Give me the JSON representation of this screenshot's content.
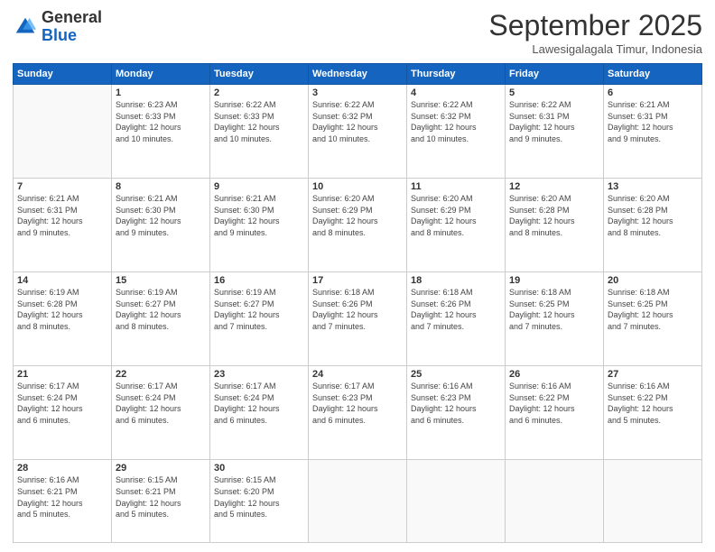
{
  "logo": {
    "line1": "General",
    "line2": "Blue"
  },
  "title": "September 2025",
  "subtitle": "Lawesigalagala Timur, Indonesia",
  "days_header": [
    "Sunday",
    "Monday",
    "Tuesday",
    "Wednesday",
    "Thursday",
    "Friday",
    "Saturday"
  ],
  "weeks": [
    [
      {
        "day": "",
        "info": ""
      },
      {
        "day": "1",
        "info": "Sunrise: 6:23 AM\nSunset: 6:33 PM\nDaylight: 12 hours\nand 10 minutes."
      },
      {
        "day": "2",
        "info": "Sunrise: 6:22 AM\nSunset: 6:33 PM\nDaylight: 12 hours\nand 10 minutes."
      },
      {
        "day": "3",
        "info": "Sunrise: 6:22 AM\nSunset: 6:32 PM\nDaylight: 12 hours\nand 10 minutes."
      },
      {
        "day": "4",
        "info": "Sunrise: 6:22 AM\nSunset: 6:32 PM\nDaylight: 12 hours\nand 10 minutes."
      },
      {
        "day": "5",
        "info": "Sunrise: 6:22 AM\nSunset: 6:31 PM\nDaylight: 12 hours\nand 9 minutes."
      },
      {
        "day": "6",
        "info": "Sunrise: 6:21 AM\nSunset: 6:31 PM\nDaylight: 12 hours\nand 9 minutes."
      }
    ],
    [
      {
        "day": "7",
        "info": "Sunrise: 6:21 AM\nSunset: 6:31 PM\nDaylight: 12 hours\nand 9 minutes."
      },
      {
        "day": "8",
        "info": "Sunrise: 6:21 AM\nSunset: 6:30 PM\nDaylight: 12 hours\nand 9 minutes."
      },
      {
        "day": "9",
        "info": "Sunrise: 6:21 AM\nSunset: 6:30 PM\nDaylight: 12 hours\nand 9 minutes."
      },
      {
        "day": "10",
        "info": "Sunrise: 6:20 AM\nSunset: 6:29 PM\nDaylight: 12 hours\nand 8 minutes."
      },
      {
        "day": "11",
        "info": "Sunrise: 6:20 AM\nSunset: 6:29 PM\nDaylight: 12 hours\nand 8 minutes."
      },
      {
        "day": "12",
        "info": "Sunrise: 6:20 AM\nSunset: 6:28 PM\nDaylight: 12 hours\nand 8 minutes."
      },
      {
        "day": "13",
        "info": "Sunrise: 6:20 AM\nSunset: 6:28 PM\nDaylight: 12 hours\nand 8 minutes."
      }
    ],
    [
      {
        "day": "14",
        "info": "Sunrise: 6:19 AM\nSunset: 6:28 PM\nDaylight: 12 hours\nand 8 minutes."
      },
      {
        "day": "15",
        "info": "Sunrise: 6:19 AM\nSunset: 6:27 PM\nDaylight: 12 hours\nand 8 minutes."
      },
      {
        "day": "16",
        "info": "Sunrise: 6:19 AM\nSunset: 6:27 PM\nDaylight: 12 hours\nand 7 minutes."
      },
      {
        "day": "17",
        "info": "Sunrise: 6:18 AM\nSunset: 6:26 PM\nDaylight: 12 hours\nand 7 minutes."
      },
      {
        "day": "18",
        "info": "Sunrise: 6:18 AM\nSunset: 6:26 PM\nDaylight: 12 hours\nand 7 minutes."
      },
      {
        "day": "19",
        "info": "Sunrise: 6:18 AM\nSunset: 6:25 PM\nDaylight: 12 hours\nand 7 minutes."
      },
      {
        "day": "20",
        "info": "Sunrise: 6:18 AM\nSunset: 6:25 PM\nDaylight: 12 hours\nand 7 minutes."
      }
    ],
    [
      {
        "day": "21",
        "info": "Sunrise: 6:17 AM\nSunset: 6:24 PM\nDaylight: 12 hours\nand 6 minutes."
      },
      {
        "day": "22",
        "info": "Sunrise: 6:17 AM\nSunset: 6:24 PM\nDaylight: 12 hours\nand 6 minutes."
      },
      {
        "day": "23",
        "info": "Sunrise: 6:17 AM\nSunset: 6:24 PM\nDaylight: 12 hours\nand 6 minutes."
      },
      {
        "day": "24",
        "info": "Sunrise: 6:17 AM\nSunset: 6:23 PM\nDaylight: 12 hours\nand 6 minutes."
      },
      {
        "day": "25",
        "info": "Sunrise: 6:16 AM\nSunset: 6:23 PM\nDaylight: 12 hours\nand 6 minutes."
      },
      {
        "day": "26",
        "info": "Sunrise: 6:16 AM\nSunset: 6:22 PM\nDaylight: 12 hours\nand 6 minutes."
      },
      {
        "day": "27",
        "info": "Sunrise: 6:16 AM\nSunset: 6:22 PM\nDaylight: 12 hours\nand 5 minutes."
      }
    ],
    [
      {
        "day": "28",
        "info": "Sunrise: 6:16 AM\nSunset: 6:21 PM\nDaylight: 12 hours\nand 5 minutes."
      },
      {
        "day": "29",
        "info": "Sunrise: 6:15 AM\nSunset: 6:21 PM\nDaylight: 12 hours\nand 5 minutes."
      },
      {
        "day": "30",
        "info": "Sunrise: 6:15 AM\nSunset: 6:20 PM\nDaylight: 12 hours\nand 5 minutes."
      },
      {
        "day": "",
        "info": ""
      },
      {
        "day": "",
        "info": ""
      },
      {
        "day": "",
        "info": ""
      },
      {
        "day": "",
        "info": ""
      }
    ]
  ]
}
